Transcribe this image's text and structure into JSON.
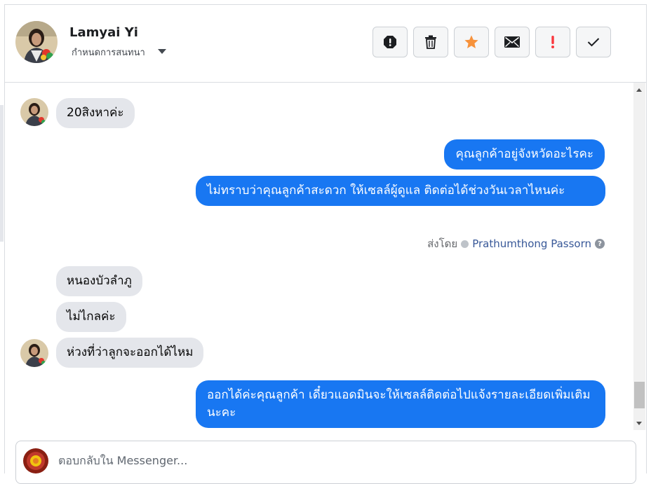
{
  "header": {
    "contact_name": "Lamyai Yi",
    "assign_label": "กำหนดการสนทนา"
  },
  "actions": [
    {
      "name": "spam",
      "icon": "octagon-exclamation-icon"
    },
    {
      "name": "delete",
      "icon": "trash-icon"
    },
    {
      "name": "star",
      "icon": "star-icon",
      "color": "#f7923b"
    },
    {
      "name": "mark-unread",
      "icon": "envelope-icon"
    },
    {
      "name": "follow-up",
      "icon": "exclamation-icon",
      "color": "#fa383e"
    },
    {
      "name": "done",
      "icon": "checkmark-icon"
    }
  ],
  "messages": [
    {
      "from": "customer",
      "text": "20สิงหาค่ะ"
    },
    {
      "from": "page",
      "text": "คุณลูกค้าอยู่จังหวัดอะไรคะ"
    },
    {
      "from": "page",
      "text": "ไม่ทราบว่าคุณลูกค้าสะดวก ให้เซลล์ผู้ดูแล ติดต่อได้ช่วงวันเวลาไหนค่ะ"
    },
    {
      "from": "customer",
      "text": "หนองบัวลำภู"
    },
    {
      "from": "customer",
      "text": "ไม่ไกลค่ะ"
    },
    {
      "from": "customer",
      "text": "ห่วงที่ว่าลูกจะออกได้ไหม"
    },
    {
      "from": "page",
      "text": "ออกได้ค่ะคุณลูกค้า เดี๋ยวแอดมินจะให้เซลล์ติดต่อไปแจ้งรายละเอียดเพิ่มเติมนะคะ"
    }
  ],
  "sent_by": {
    "label": "ส่งโดย",
    "agent": "Prathumthong Passorn",
    "help": "?"
  },
  "composer": {
    "placeholder": "ตอบกลับใน Messenger..."
  },
  "colors": {
    "outgoing_bubble": "#1877f2",
    "incoming_bubble": "#e4e6eb"
  }
}
